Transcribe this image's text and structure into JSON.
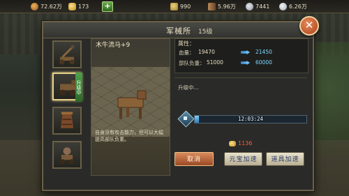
{
  "resources": {
    "copper": "72.62万",
    "ingot": "173",
    "grain": "990",
    "wood": "5.96万",
    "iron": "7441",
    "silver": "6.26万"
  },
  "panel": {
    "title": "军械所",
    "level": "15级"
  },
  "unit": {
    "name": "木牛流马+9",
    "description": "自身没有攻击能力，但可以大幅提高部队负重。",
    "status_tag": "升级中"
  },
  "attributes": {
    "title": "属性：",
    "stats": [
      {
        "label": "血量：",
        "current": "19470",
        "next": "21450"
      },
      {
        "label": "部队负重：",
        "current": "51000",
        "next": "60000"
      }
    ]
  },
  "upgrade": {
    "status_text": "升级中...",
    "timer": "12:03:24",
    "progress": 0.04
  },
  "cost": {
    "amount": "1136"
  },
  "buttons": {
    "cancel": "取消",
    "ingot_speedup": "元宝加速",
    "item_speedup": "道具加速"
  },
  "icons": [
    "copper-icon",
    "ingot-icon",
    "grain-icon",
    "wood-icon",
    "iron-icon",
    "silver-icon",
    "close-icon",
    "timer-icon"
  ]
}
